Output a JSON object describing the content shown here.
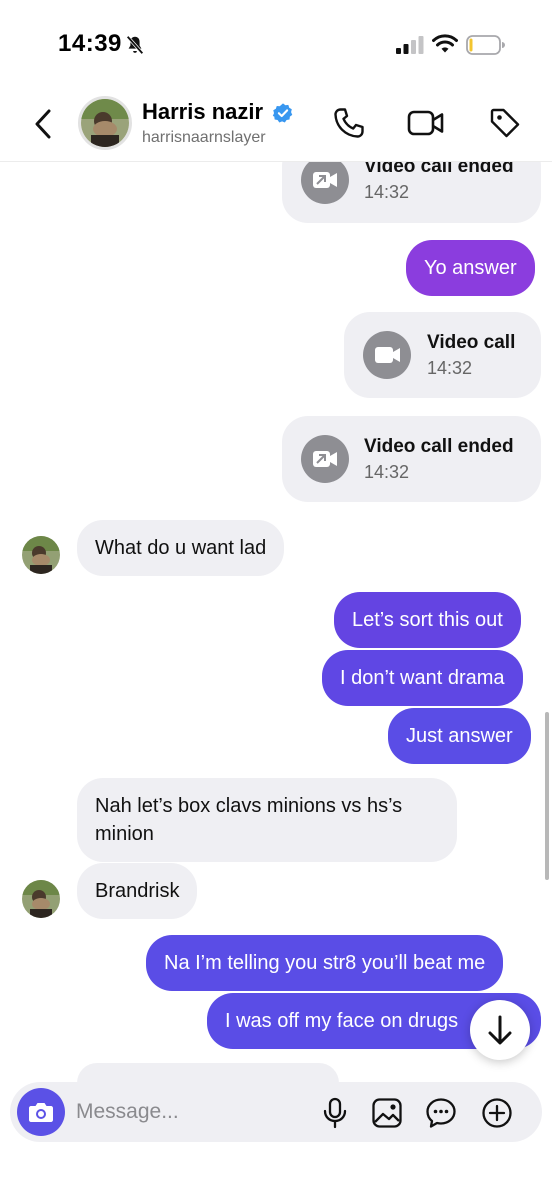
{
  "status_bar": {
    "time": "14:39",
    "icons": [
      "bell-slash-icon",
      "signal-icon",
      "wifi-icon",
      "battery-icon"
    ]
  },
  "header": {
    "name": "Harris nazir",
    "username": "harrisnaarnslayer",
    "verified": true,
    "icons": [
      "back-icon",
      "phone-icon",
      "video-icon",
      "tag-icon"
    ]
  },
  "colors": {
    "outgoing_purple": "#8b3dde",
    "outgoing_violet": "#5a4de6",
    "incoming_bg": "#efeff3",
    "verified_blue": "#3897f0",
    "camera_button": "#5b51e6"
  },
  "messages": [
    {
      "type": "call",
      "direction": "out",
      "title": "Video call ended",
      "time": "14:32"
    },
    {
      "type": "text",
      "direction": "out",
      "text": "Yo answer"
    },
    {
      "type": "call",
      "direction": "out",
      "title": "Video call",
      "time": "14:32"
    },
    {
      "type": "call",
      "direction": "out",
      "title": "Video call ended",
      "time": "14:32"
    },
    {
      "type": "text",
      "direction": "in",
      "text": "What do u want lad"
    },
    {
      "type": "text",
      "direction": "out",
      "text": "Let’s sort this out"
    },
    {
      "type": "text",
      "direction": "out",
      "text": "I don’t want drama"
    },
    {
      "type": "text",
      "direction": "out",
      "text": "Just answer"
    },
    {
      "type": "text",
      "direction": "in",
      "text_line1": "Nah let’s box clavs minions vs hs’s",
      "text_line2": "minion"
    },
    {
      "type": "text",
      "direction": "in",
      "text": "Brandrisk"
    },
    {
      "type": "text",
      "direction": "out",
      "text": "Na I’m telling you str8 you’ll beat me"
    },
    {
      "type": "text",
      "direction": "out",
      "text": "I was off my face on drugs"
    }
  ],
  "composer": {
    "placeholder": "Message...",
    "icons": [
      "camera-icon",
      "microphone-icon",
      "gallery-icon",
      "sticker-icon",
      "plus-icon"
    ]
  }
}
